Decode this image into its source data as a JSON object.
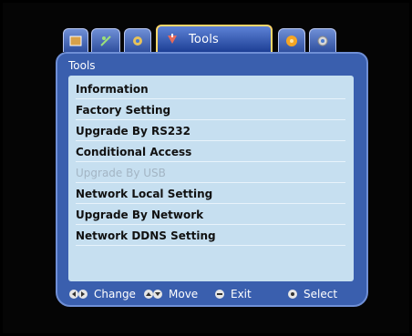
{
  "tabs": [
    {
      "icon": "picture-icon"
    },
    {
      "icon": "plug-icon"
    },
    {
      "icon": "globe-icon"
    },
    {
      "icon": "tools-icon",
      "label": "Tools",
      "active": true
    },
    {
      "icon": "orange-disc-icon"
    },
    {
      "icon": "gear-icon"
    }
  ],
  "panel": {
    "title": "Tools"
  },
  "menu": [
    {
      "label": "Information"
    },
    {
      "label": "Factory Setting"
    },
    {
      "label": "Upgrade By RS232"
    },
    {
      "label": "Conditional Access"
    },
    {
      "label": "Upgrade By USB",
      "disabled": true
    },
    {
      "label": "Network Local Setting"
    },
    {
      "label": "Upgrade By Network"
    },
    {
      "label": "Network DDNS Setting"
    }
  ],
  "footer": {
    "change": "Change",
    "move": "Move",
    "exit": "Exit",
    "select": "Select"
  }
}
